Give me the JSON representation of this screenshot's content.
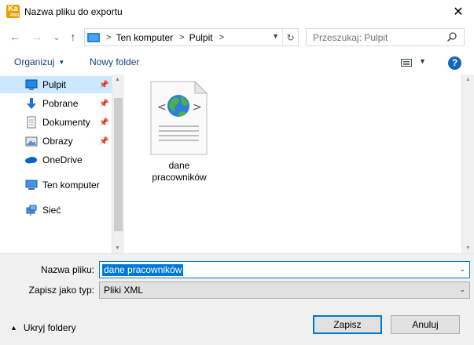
{
  "window": {
    "title": "Nazwa pliku do exportu",
    "app_icon_text": "Ka",
    "app_icon_sub": "PRO",
    "close_glyph": "✕"
  },
  "nav": {
    "back_glyph": "←",
    "forward_glyph": "→",
    "recent_glyph": "⌄",
    "up_glyph": "↑",
    "breadcrumbs": [
      "Ten komputer",
      "Pulpit"
    ],
    "sep_glyph": ">",
    "refresh_glyph": "↻",
    "search_placeholder": "Przeszukaj: Pulpit"
  },
  "toolbar": {
    "organize_label": "Organizuj",
    "new_folder_label": "Nowy folder",
    "help_glyph": "?"
  },
  "sidebar": {
    "items": [
      {
        "label": "Pulpit",
        "icon": "desktop-icon",
        "pinned": true,
        "selected": true
      },
      {
        "label": "Pobrane",
        "icon": "download-icon",
        "pinned": true
      },
      {
        "label": "Dokumenty",
        "icon": "documents-icon",
        "pinned": true
      },
      {
        "label": "Obrazy",
        "icon": "pictures-icon",
        "pinned": true
      },
      {
        "label": "OneDrive",
        "icon": "onedrive-icon"
      },
      {
        "label": "Ten komputer",
        "icon": "computer-icon"
      },
      {
        "label": "Sieć",
        "icon": "network-icon"
      }
    ],
    "pin_glyph": "📌"
  },
  "content": {
    "files": [
      {
        "name": "dane pracowników",
        "icon": "xml-file-icon"
      }
    ]
  },
  "form": {
    "filename_label": "Nazwa pliku:",
    "filename_value": "dane pracowników",
    "filetype_label": "Zapisz jako typ:",
    "filetype_value": "Pliki XML",
    "hide_folders_label": "Ukryj foldery",
    "save_label": "Zapisz",
    "cancel_label": "Anuluj"
  },
  "colors": {
    "accent": "#0078d7",
    "selection_bg": "#cce8ff",
    "footer_bg": "#f0f0f0"
  }
}
